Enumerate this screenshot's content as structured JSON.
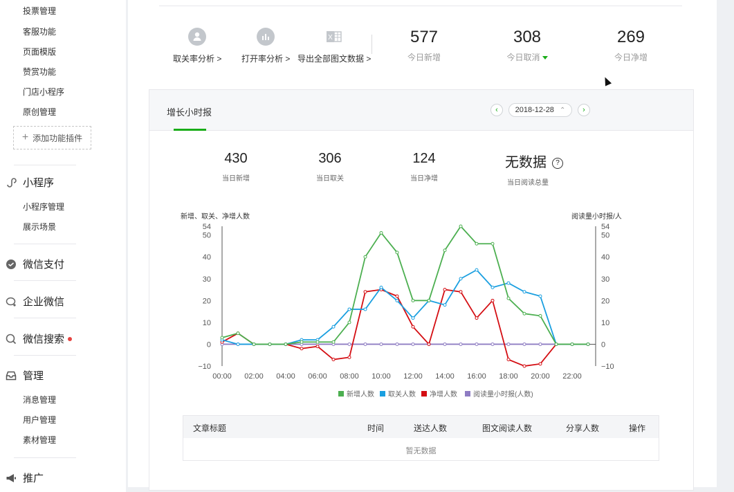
{
  "sidebar": {
    "items": [
      {
        "label": "投票管理"
      },
      {
        "label": "客服功能"
      },
      {
        "label": "页面模版"
      },
      {
        "label": "赞赏功能"
      },
      {
        "label": "门店小程序"
      },
      {
        "label": "原创管理"
      }
    ],
    "add_plugin": "添加功能插件",
    "mini_program": {
      "label": "小程序",
      "items": [
        {
          "label": "小程序管理"
        },
        {
          "label": "展示场景"
        }
      ]
    },
    "wechat_pay": "微信支付",
    "work_wechat": "企业微信",
    "wechat_search": "微信搜索",
    "manage": {
      "label": "管理",
      "items": [
        {
          "label": "消息管理"
        },
        {
          "label": "用户管理"
        },
        {
          "label": "素材管理"
        }
      ]
    },
    "promote": "推广"
  },
  "toolbar": {
    "unfollow_analysis": "取关率分析",
    "open_analysis": "打开率分析",
    "export_all": "导出全部图文数据"
  },
  "today": {
    "new": {
      "value": "577",
      "label": "今日新增"
    },
    "cancel": {
      "value": "308",
      "label": "今日取消"
    },
    "net": {
      "value": "269",
      "label": "今日净增"
    }
  },
  "hourly": {
    "title": "增长小时报",
    "date": "2018-12-28",
    "stats": [
      {
        "value": "430",
        "label": "当日新增"
      },
      {
        "value": "306",
        "label": "当日取关"
      },
      {
        "value": "124",
        "label": "当日净增"
      },
      {
        "value": "无数据",
        "label": "当日阅读总量"
      }
    ]
  },
  "chart_data": {
    "type": "line",
    "ylabel": "新增、取关、净增人数",
    "ylabel_right": "阅读量小时报/人",
    "ylim": [
      -10,
      54
    ],
    "y_ticks": [
      -10,
      0,
      10,
      20,
      30,
      40,
      50,
      54
    ],
    "x_labels": [
      "00:00",
      "02:00",
      "04:00",
      "06:00",
      "08:00",
      "10:00",
      "12:00",
      "14:00",
      "16:00",
      "18:00",
      "20:00",
      "22:00"
    ],
    "x": [
      0,
      1,
      2,
      3,
      4,
      5,
      6,
      7,
      8,
      9,
      10,
      11,
      12,
      13,
      14,
      15,
      16,
      17,
      18,
      19,
      20,
      21,
      22,
      23
    ],
    "grid": false,
    "legend_position": "bottom",
    "series": [
      {
        "name": "新增人数",
        "color": "#4caf50",
        "values": [
          3,
          5,
          0,
          0,
          0,
          1,
          1,
          1,
          10,
          40,
          51,
          42,
          20,
          20,
          43,
          54,
          46,
          46,
          21,
          14,
          13,
          0,
          0,
          0
        ]
      },
      {
        "name": "取关人数",
        "color": "#1a9fe0",
        "values": [
          2,
          0,
          0,
          0,
          0,
          2,
          2,
          8,
          16,
          16,
          26,
          20,
          12,
          20,
          18,
          30,
          34,
          26,
          28,
          24,
          22,
          0,
          0,
          0
        ]
      },
      {
        "name": "净增人数",
        "color": "#d40d12",
        "values": [
          1,
          5,
          0,
          0,
          0,
          -2,
          -1,
          -7,
          -6,
          24,
          25,
          22,
          8,
          0,
          25,
          24,
          12,
          20,
          -7,
          -10,
          -9,
          0,
          0,
          0
        ]
      },
      {
        "name": "阅读量小时报(人数)",
        "color": "#8e7cc3",
        "values": [
          0,
          0,
          0,
          0,
          0,
          0,
          0,
          0,
          0,
          0,
          0,
          0,
          0,
          0,
          0,
          0,
          0,
          0,
          0,
          0,
          0,
          0,
          0,
          0
        ]
      }
    ]
  },
  "articles": {
    "columns": [
      "文章标题",
      "时间",
      "送达人数",
      "图文阅读人数",
      "分享人数",
      "操作"
    ],
    "empty": "暂无数据"
  }
}
